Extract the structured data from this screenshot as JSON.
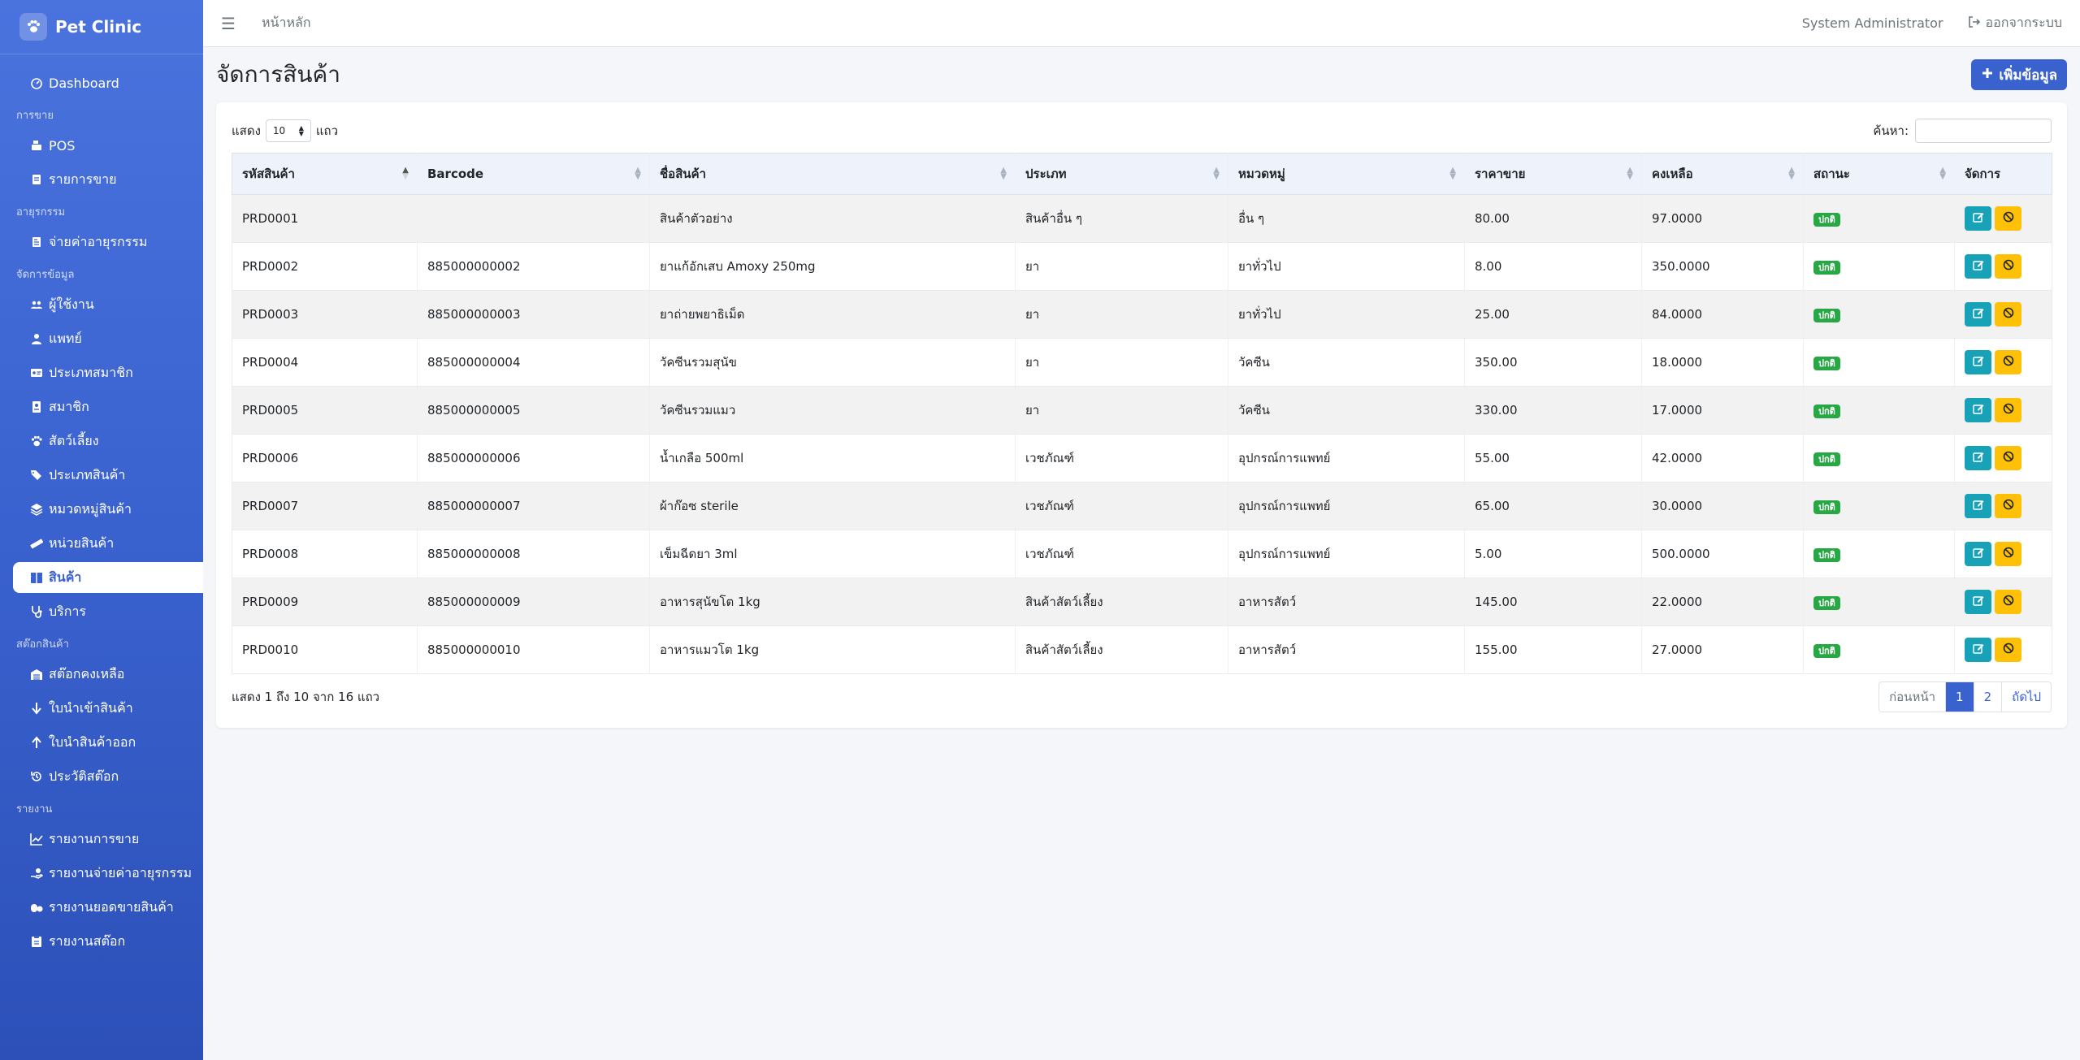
{
  "brand": {
    "name": "Pet Clinic"
  },
  "sidebar": {
    "dashboard": "Dashboard",
    "sections": [
      {
        "header": "การขาย",
        "items": [
          {
            "label": "POS",
            "icon": "cash-register-icon"
          },
          {
            "label": "รายการขาย",
            "icon": "receipt-icon"
          }
        ]
      },
      {
        "header": "อายุรกรรม",
        "items": [
          {
            "label": "จ่ายค่าอายุรกรรม",
            "icon": "invoice-icon"
          }
        ]
      },
      {
        "header": "จัดการข้อมูล",
        "items": [
          {
            "label": "ผู้ใช้งาน",
            "icon": "users-icon"
          },
          {
            "label": "แพทย์",
            "icon": "doctor-icon"
          },
          {
            "label": "ประเภทสมาชิก",
            "icon": "id-card-icon"
          },
          {
            "label": "สมาชิก",
            "icon": "member-icon"
          },
          {
            "label": "สัตว์เลี้ยง",
            "icon": "paw-icon"
          },
          {
            "label": "ประเภทสินค้า",
            "icon": "tags-icon"
          },
          {
            "label": "หมวดหมู่สินค้า",
            "icon": "layers-icon"
          },
          {
            "label": "หน่วยสินค้า",
            "icon": "ruler-icon"
          },
          {
            "label": "สินค้า",
            "icon": "box-icon",
            "active": true
          },
          {
            "label": "บริการ",
            "icon": "stethoscope-icon"
          }
        ]
      },
      {
        "header": "สต๊อกสินค้า",
        "items": [
          {
            "label": "สต๊อกคงเหลือ",
            "icon": "warehouse-icon"
          },
          {
            "label": "ใบนำเข้าสินค้า",
            "icon": "arrow-down-icon"
          },
          {
            "label": "ใบนำสินค้าออก",
            "icon": "arrow-up-icon"
          },
          {
            "label": "ประวัติสต๊อก",
            "icon": "history-icon"
          }
        ]
      },
      {
        "header": "รายงาน",
        "items": [
          {
            "label": "รายงานการขาย",
            "icon": "chart-line-icon"
          },
          {
            "label": "รายงานจ่ายค่าอายุรกรรม",
            "icon": "hand-money-icon"
          },
          {
            "label": "รายงานยอดขายสินค้า",
            "icon": "pills-icon"
          },
          {
            "label": "รายงานสต๊อก",
            "icon": "clipboard-icon"
          }
        ]
      }
    ]
  },
  "topbar": {
    "breadcrumb": "หน้าหลัก",
    "user": "System Administrator",
    "logout": "ออกจากระบบ"
  },
  "page": {
    "title": "จัดการสินค้า",
    "add_button": "เพิ่มข้อมูล"
  },
  "table": {
    "length_prefix": "แสดง",
    "length_value": "10",
    "length_suffix": "แถว",
    "search_label": "ค้นหา:",
    "columns": [
      "รหัสสินค้า",
      "Barcode",
      "ชื่อสินค้า",
      "ประเภท",
      "หมวดหมู่",
      "ราคาขาย",
      "คงเหลือ",
      "สถานะ",
      "จัดการ"
    ],
    "rows": [
      {
        "code": "PRD0001",
        "barcode": "",
        "name": "สินค้าตัวอย่าง",
        "type": "สินค้าอื่น ๆ",
        "category": "อื่น ๆ",
        "price": "80.00",
        "stock": "97.0000",
        "status": "ปกติ"
      },
      {
        "code": "PRD0002",
        "barcode": "885000000002",
        "name": "ยาแก้อักเสบ Amoxy 250mg",
        "type": "ยา",
        "category": "ยาทั่วไป",
        "price": "8.00",
        "stock": "350.0000",
        "status": "ปกติ"
      },
      {
        "code": "PRD0003",
        "barcode": "885000000003",
        "name": "ยาถ่ายพยาธิเม็ด",
        "type": "ยา",
        "category": "ยาทั่วไป",
        "price": "25.00",
        "stock": "84.0000",
        "status": "ปกติ"
      },
      {
        "code": "PRD0004",
        "barcode": "885000000004",
        "name": "วัคซีนรวมสุนัข",
        "type": "ยา",
        "category": "วัคซีน",
        "price": "350.00",
        "stock": "18.0000",
        "status": "ปกติ"
      },
      {
        "code": "PRD0005",
        "barcode": "885000000005",
        "name": "วัคซีนรวมแมว",
        "type": "ยา",
        "category": "วัคซีน",
        "price": "330.00",
        "stock": "17.0000",
        "status": "ปกติ"
      },
      {
        "code": "PRD0006",
        "barcode": "885000000006",
        "name": "น้ำเกลือ 500ml",
        "type": "เวชภัณฑ์",
        "category": "อุปกรณ์การแพทย์",
        "price": "55.00",
        "stock": "42.0000",
        "status": "ปกติ"
      },
      {
        "code": "PRD0007",
        "barcode": "885000000007",
        "name": "ผ้าก๊อซ sterile",
        "type": "เวชภัณฑ์",
        "category": "อุปกรณ์การแพทย์",
        "price": "65.00",
        "stock": "30.0000",
        "status": "ปกติ"
      },
      {
        "code": "PRD0008",
        "barcode": "885000000008",
        "name": "เข็มฉีดยา 3ml",
        "type": "เวชภัณฑ์",
        "category": "อุปกรณ์การแพทย์",
        "price": "5.00",
        "stock": "500.0000",
        "status": "ปกติ"
      },
      {
        "code": "PRD0009",
        "barcode": "885000000009",
        "name": "อาหารสุนัขโต 1kg",
        "type": "สินค้าสัตว์เลี้ยง",
        "category": "อาหารสัตว์",
        "price": "145.00",
        "stock": "22.0000",
        "status": "ปกติ"
      },
      {
        "code": "PRD0010",
        "barcode": "885000000010",
        "name": "อาหารแมวโต 1kg",
        "type": "สินค้าสัตว์เลี้ยง",
        "category": "อาหารสัตว์",
        "price": "155.00",
        "stock": "27.0000",
        "status": "ปกติ"
      }
    ],
    "info": "แสดง 1 ถึง 10 จาก 16 แถว",
    "pagination": {
      "prev": "ก่อนหน้า",
      "pages": [
        "1",
        "2"
      ],
      "next": "ถัดไป"
    }
  }
}
